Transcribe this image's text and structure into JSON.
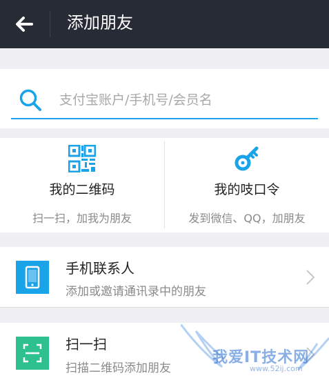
{
  "header": {
    "title": "添加朋友"
  },
  "search": {
    "placeholder": "支付宝账户/手机号/会员名",
    "value": ""
  },
  "tiles": [
    {
      "title": "我的二维码",
      "subtitle": "扫一扫，加我为朋友",
      "icon": "qr-code-icon"
    },
    {
      "title": "我的吱口令",
      "subtitle": "发到微信、QQ，加朋友",
      "icon": "key-icon"
    }
  ],
  "rows": [
    {
      "title": "手机联系人",
      "subtitle": "添加或邀请通讯录中的朋友",
      "icon": "phone-icon",
      "color": "#1aa3e8"
    },
    {
      "title": "扫一扫",
      "subtitle": "扫描二维码添加朋友",
      "icon": "scan-icon",
      "color": "#2ec18f"
    }
  ],
  "watermark": {
    "text": "我爱IT技术网",
    "url": "www.52ij.com"
  },
  "colors": {
    "header_bg": "#262b36",
    "accent": "#1aa3e8",
    "scan_green": "#2ec18f"
  }
}
